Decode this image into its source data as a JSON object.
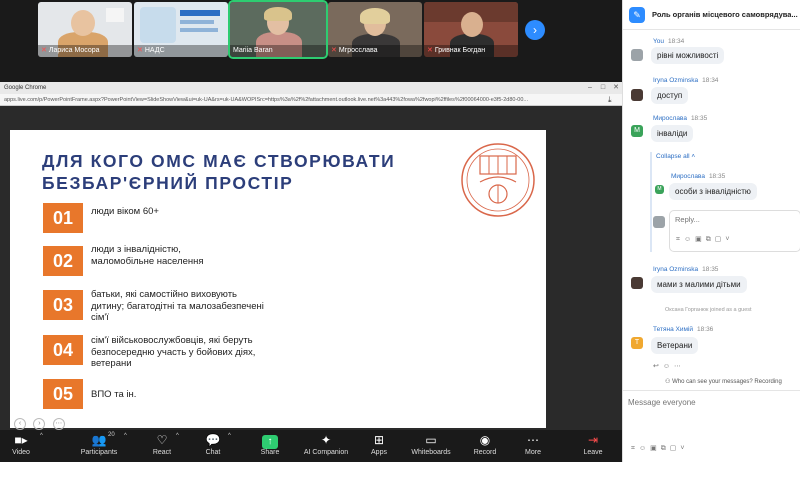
{
  "gallery": {
    "tiles": [
      {
        "name": "Лариса Мосора"
      },
      {
        "name": "НАДС"
      },
      {
        "name": "Mariia Baran"
      },
      {
        "name": "Мгросслава"
      },
      {
        "name": "Гривнак Богдан"
      }
    ]
  },
  "browser": {
    "title": "Google Chrome",
    "url": "apps.live.com/p/PowerPointFrame.aspx?PowerPointView=SlideShowView&ui=uk-UA&rs=uk-UA&WOPISrc=https%3a%2f%2fattachment.outlook.live.net%3a443%2fowa%2fwopi%2ffiles%2f00064000-e3f5-2d80-00..."
  },
  "slide": {
    "title": "ДЛЯ КОГО ОМС МАЄ СТВОРЮВАТИ БЕЗБАР'ЄРНИЙ ПРОСТІР",
    "items": [
      {
        "num": "01",
        "text": "люди віком 60+"
      },
      {
        "num": "02",
        "text": "люди з інвалідністю,\nмаломобільне населення"
      },
      {
        "num": "03",
        "text": "батьки, які самостійно виховують\nдитину; багатодітні та малозабезпечені\nсім'ї"
      },
      {
        "num": "04",
        "text": "сім'ї військовослужбовців, які беруть\nбезпосередню участь у бойових діях,\nветерани"
      },
      {
        "num": "05",
        "text": "ВПО та ін."
      }
    ],
    "colors": {
      "accent": "#e8772b",
      "title": "#2c3e7a"
    }
  },
  "toolbar": {
    "video": "Video",
    "participants": "Participants",
    "participants_count": "20",
    "react": "React",
    "chat": "Chat",
    "share": "Share",
    "ai": "AI Companion",
    "apps": "Apps",
    "whiteboards": "Whiteboards",
    "record": "Record",
    "more": "More",
    "leave": "Leave"
  },
  "chat": {
    "title": "Роль органів місцевого самоврядува...",
    "messages": [
      {
        "sender": "You",
        "time": "18:34",
        "text": "рівні можливості"
      },
      {
        "sender": "Iryna Ozminska",
        "time": "18:34",
        "text": "доступ"
      },
      {
        "sender": "Мирослава",
        "time": "18:35",
        "text": "інваліди"
      },
      {
        "sender": "Мирослава",
        "time": "18:35",
        "text": "особи з інвалідністю"
      },
      {
        "sender": "Iryna Ozminska",
        "time": "18:35",
        "text": "мами з малими дітьми"
      },
      {
        "sender": "Тетяна Химій",
        "time": "18:36",
        "text": "Ветерани"
      }
    ],
    "collapse_all": "Collapse all",
    "reply_placeholder": "Reply...",
    "system_joined": "Оксана Горганюк joined as a guest",
    "who_can_see": "Who can see your messages? Recording",
    "message_placeholder": "Message everyone"
  }
}
